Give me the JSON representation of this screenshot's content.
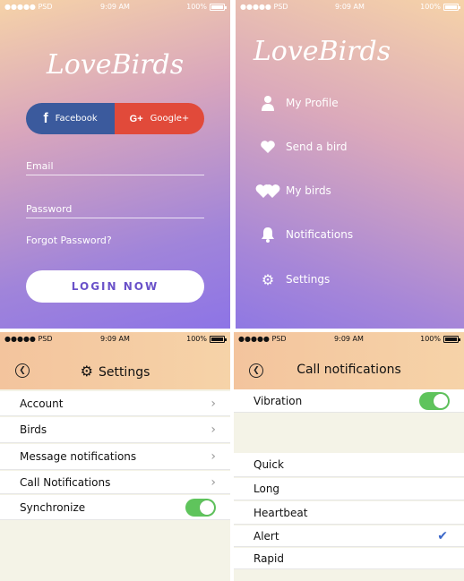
{
  "status": {
    "carrier": "●●●●● PSD",
    "time": "9:09 AM",
    "battery": "100%"
  },
  "logo": "LoveBirds",
  "login": {
    "facebook_icon": "f",
    "facebook_label": "Facebook",
    "google_icon": "G+",
    "google_label": "Google+",
    "email_placeholder": "Email",
    "password_placeholder": "Password",
    "forgot": "Forgot Password?",
    "button": "LOGIN NOW"
  },
  "menu": {
    "items": [
      {
        "label": "My Profile",
        "icon": "person-icon"
      },
      {
        "label": "Send a bird",
        "icon": "heart-icon"
      },
      {
        "label": "My birds",
        "icon": "double-heart-icon"
      },
      {
        "label": "Notifications",
        "icon": "bell-icon"
      },
      {
        "label": "Settings",
        "icon": "gear-icon"
      }
    ]
  },
  "settings": {
    "title": "Settings",
    "rows": [
      {
        "label": "Account"
      },
      {
        "label": "Birds"
      },
      {
        "label": "Message notifications"
      },
      {
        "label": "Call Notifications"
      },
      {
        "label": "Synchronize"
      }
    ]
  },
  "call_notifications": {
    "title": "Call notifications",
    "vibration": "Vibration",
    "options": [
      "Quick",
      "Long",
      "Heartbeat",
      "Alert",
      "Rapid"
    ],
    "selected": "Alert"
  },
  "colors": {
    "facebook": "#3b5a9d",
    "google": "#e14a3a",
    "toggle_on": "#5fc45c",
    "check": "#3a66c8",
    "login_text": "#6a52c9"
  }
}
